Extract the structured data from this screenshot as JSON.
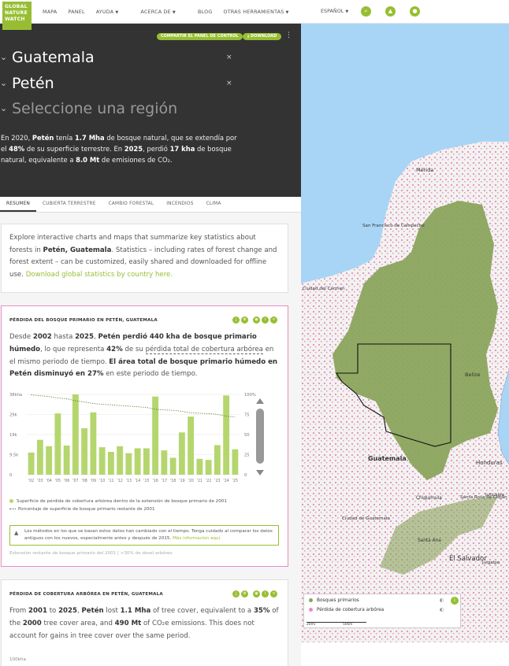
{
  "logo": {
    "line1": "GLOBAL",
    "line2": "NATURE",
    "line3": "WATCH"
  },
  "nav": {
    "items": [
      "MAPA",
      "PANEL",
      "AYUDA",
      "ACERCA DE",
      "BLOG",
      "OTRAS HERRAMIENTAS"
    ],
    "language": "ESPAÑOL"
  },
  "header": {
    "share_label": "COMPARTIR EL PANEL DE CONTROL",
    "download_label": "DOWNLOAD",
    "country": "Guatemala",
    "region": "Petén",
    "subregion_placeholder": "Seleccione una región",
    "summary": {
      "p1": "En 2020,",
      "place": "Petén",
      "p2": "tenía",
      "area": "1.7 Mha",
      "p3": "de bosque natural, que se extendía por el",
      "pct": "48%",
      "p4": "de su superficie terrestre. En",
      "year": "2025",
      "p5": ", perdió",
      "loss": "17 kha",
      "p6": "de bosque natural, equivalente a",
      "emis": "8.0 Mt",
      "p7": "de emisiones de CO₂."
    }
  },
  "tabs": [
    "RESUMEN",
    "CUBIERTA TERRESTRE",
    "CAMBIO FORESTAL",
    "INCENDIOS",
    "CLIMA"
  ],
  "intro": {
    "t1": "Explore interactive charts and maps that summarize key statistics about forests in",
    "place": "Petén, Guatemala",
    "t2": ". Statistics – including rates of forest change and forest extent – can be customized, easily shared and downloaded for offline use.",
    "link": "Download global statistics by country here."
  },
  "primary_loss": {
    "title": "PÉRDIDA DEL BOSQUE PRIMARIO EN PETÉN, GUATEMALA",
    "s1": "Desde",
    "y1": "2002",
    "s2": "hasta",
    "y2": "2025",
    "s3": ",",
    "b1": "Petén perdió 440 kha de bosque primario húmedo",
    "s4": ", lo que representa",
    "pct": "42%",
    "s5": "de su",
    "link": "pérdida total de cobertura arbórea",
    "s6": "en el mismo periodo de tiempo.",
    "b2": "El área total de bosque primario húmedo en Petén disminuyó en 27%",
    "s7": "en este periodo de tiempo.",
    "legend_bar": "Superficie de pérdida de cobertura arbórea dentro de la extensión de bosque primario de 2001",
    "legend_line": "Porcentaje de superficie de bosque primario restante de 2001",
    "warning": "Los métodos en los que se basan estos datos han cambiado con el tiempo. Tenga cuidado al comparar los datos antiguos con los nuevos, especialmente antes y después de 2015.",
    "warning_link": "Más información aquí.",
    "footnote": "Extensión restante de bosque primario del 2001 | >30% de dosel arbóreo"
  },
  "tree_loss": {
    "title": "PÉRDIDA DE COBERTURA ARBÓREA EN PETÉN, GUATEMALA",
    "s1": "From",
    "y1": "2001",
    "s2": "to",
    "y2": "2025",
    "s3": ",",
    "b1": "Petén",
    "s4": "lost",
    "loss": "1.1 Mha",
    "s5": "of tree cover, equivalent to a",
    "pct": "35%",
    "s6": "of the",
    "y3": "2000",
    "s7": "tree cover area, and",
    "emis": "490 Mt",
    "s8": "of CO₂e emissions. This does not account for gains in tree cover over the same period.",
    "yaxis_top": "100kha"
  },
  "chart_data": {
    "type": "bar",
    "categories": [
      "'02",
      "'03",
      "'04",
      "'05",
      "'06",
      "'07",
      "'08",
      "'09",
      "'10",
      "'11",
      "'12",
      "'13",
      "'14",
      "'15",
      "'16",
      "'17",
      "'18",
      "'19",
      "'20",
      "'21",
      "'22",
      "'23",
      "'24",
      "'25"
    ],
    "series": [
      {
        "name": "Superficie de pérdida de cobertura arbórea dentro de la extensión de bosque primario de 2001",
        "values": [
          10.5,
          16.5,
          13.5,
          29.0,
          13.8,
          38.0,
          22.0,
          29.5,
          13.0,
          10.8,
          13.5,
          10.2,
          12.5,
          12.5,
          37.0,
          11.5,
          8.0,
          20.0,
          27.5,
          7.5,
          7.0,
          14.0,
          37.5,
          12.0
        ]
      },
      {
        "name": "Porcentaje de superficie de bosque primario restante de 2001",
        "values": [
          99.5,
          98.3,
          97.4,
          95.5,
          94.6,
          92.0,
          90.6,
          88.6,
          87.7,
          87.0,
          86.1,
          85.4,
          84.6,
          83.8,
          81.4,
          80.7,
          80.2,
          78.9,
          77.1,
          76.6,
          76.1,
          75.2,
          72.8,
          72.0
        ]
      }
    ],
    "y_left_ticks": [
      "38kha",
      "29k",
      "19k",
      "9.5k",
      "0"
    ],
    "y_right_ticks": [
      "100%",
      "75",
      "50",
      "25",
      "0"
    ],
    "ylim": [
      0,
      38
    ],
    "ylim_right": [
      0,
      100
    ],
    "bar_color": "#b5d66e",
    "line_color": "#5a7a2a"
  },
  "map": {
    "labels": [
      "Mérida",
      "San Francisco de Campeche",
      "Ciudad del Carmen",
      "Belize",
      "Guatemala",
      "Ciudad de Guatemala",
      "Chiquimula",
      "Santa Rosa de Copán",
      "Santa Ana",
      "El Salvador",
      "Honduras",
      "Juticalpa",
      "Juigalpa"
    ],
    "legend": [
      "Bosques primarios",
      "Pérdida de cobertura arbórea"
    ],
    "scale_left": "20mi",
    "scale_right": "50km",
    "colors": {
      "forest": "#8aa45c",
      "loss": "#e58cc6",
      "water": "#a8d5f5",
      "land": "#f2f2ef"
    }
  }
}
